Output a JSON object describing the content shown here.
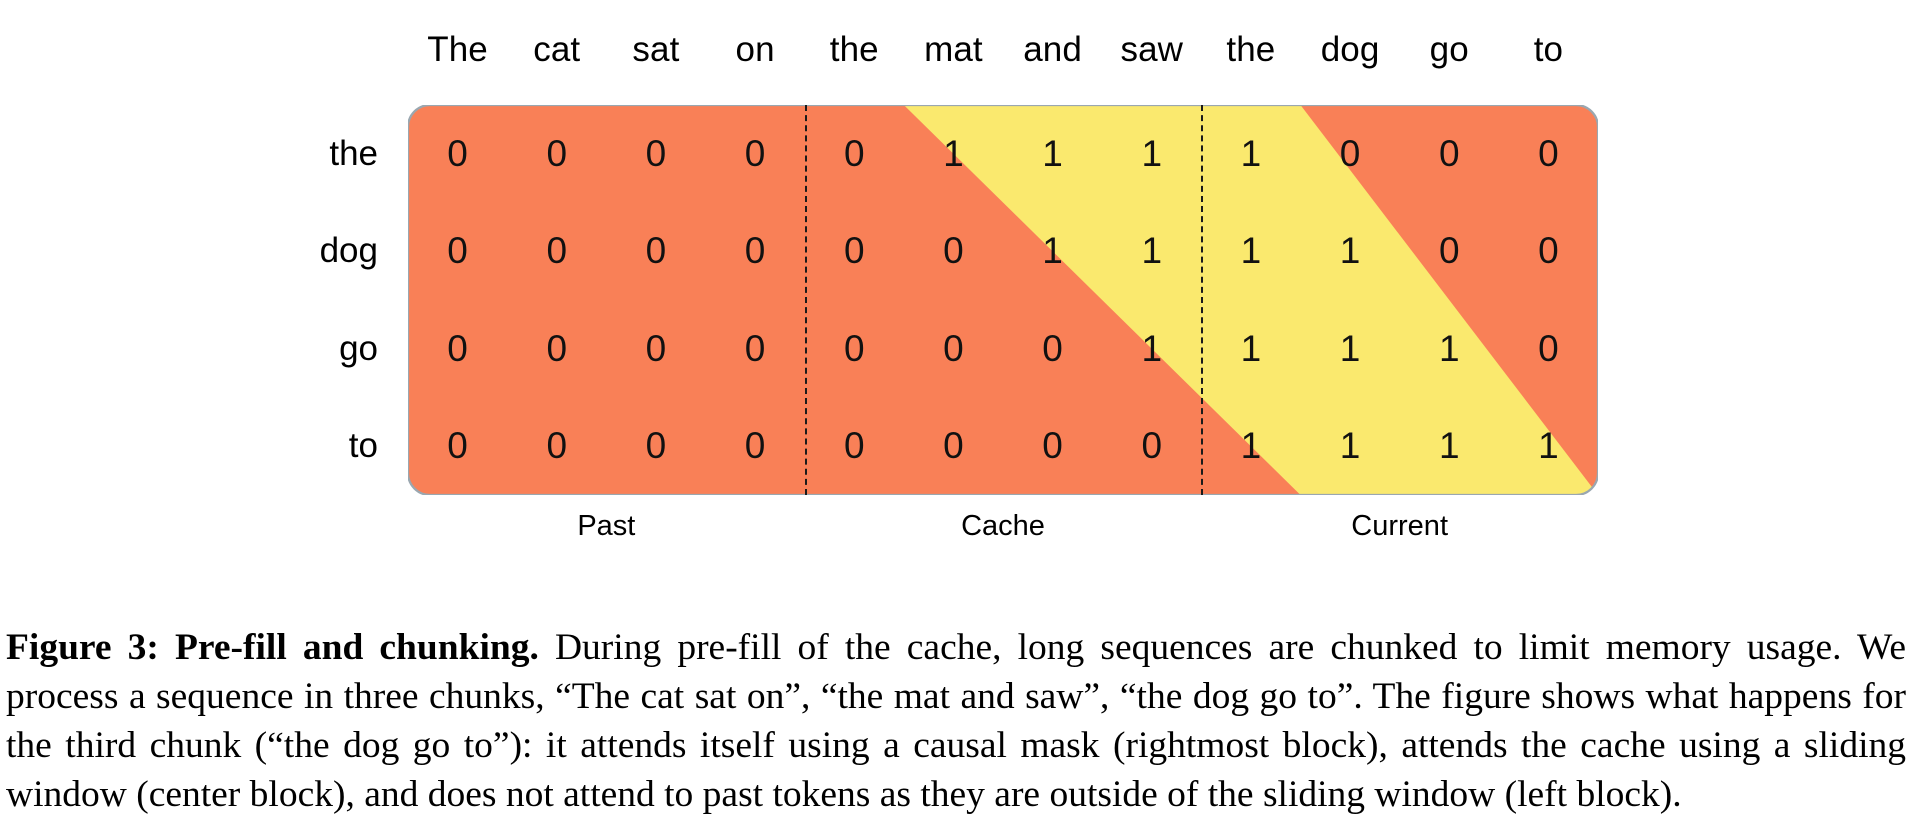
{
  "figure": {
    "columns": [
      "The",
      "cat",
      "sat",
      "on",
      "the",
      "mat",
      "and",
      "saw",
      "the",
      "dog",
      "go",
      "to"
    ],
    "rows": [
      "the",
      "dog",
      "go",
      "to"
    ],
    "group_labels": [
      "Past",
      "Cache",
      "Current"
    ],
    "colors": {
      "masked": "#F98057",
      "attended": "#FAE96E",
      "border": "#9aa7b0",
      "separator": "#1a1a1a"
    },
    "legend": {
      "masked_value": "0",
      "attended_value": "1"
    }
  },
  "chart_data": {
    "type": "heatmap",
    "title": "Pre-fill and chunking attention mask",
    "xlabel": "",
    "ylabel": "",
    "x": [
      "The",
      "cat",
      "sat",
      "on",
      "the",
      "mat",
      "and",
      "saw",
      "the",
      "dog",
      "go",
      "to"
    ],
    "y": [
      "the",
      "dog",
      "go",
      "to"
    ],
    "values": [
      [
        0,
        0,
        0,
        0,
        0,
        1,
        1,
        1,
        1,
        0,
        0,
        0
      ],
      [
        0,
        0,
        0,
        0,
        0,
        0,
        1,
        1,
        1,
        1,
        0,
        0
      ],
      [
        0,
        0,
        0,
        0,
        0,
        0,
        0,
        1,
        1,
        1,
        1,
        0
      ],
      [
        0,
        0,
        0,
        0,
        0,
        0,
        0,
        0,
        1,
        1,
        1,
        1
      ]
    ],
    "colorscale": {
      "0": "#F98057",
      "1": "#FAE96E"
    },
    "annotations": [
      "Past",
      "Cache",
      "Current"
    ],
    "chunk_boundaries": [
      4,
      8
    ],
    "grid": false,
    "legend_position": "none"
  },
  "caption": {
    "bold_prefix": "Figure 3: Pre-fill and chunking.",
    "body": " During pre-fill of the cache, long sequences are chunked to limit memory usage. We process a sequence in three chunks, “The cat sat on”, “the mat and saw”, “the dog go to”. The figure shows what happens for the third chunk (“the dog go to”): it attends itself using a causal mask (rightmost block), attends the cache using a sliding window (center block), and does not attend to past tokens as they are outside of the sliding window (left block)."
  }
}
